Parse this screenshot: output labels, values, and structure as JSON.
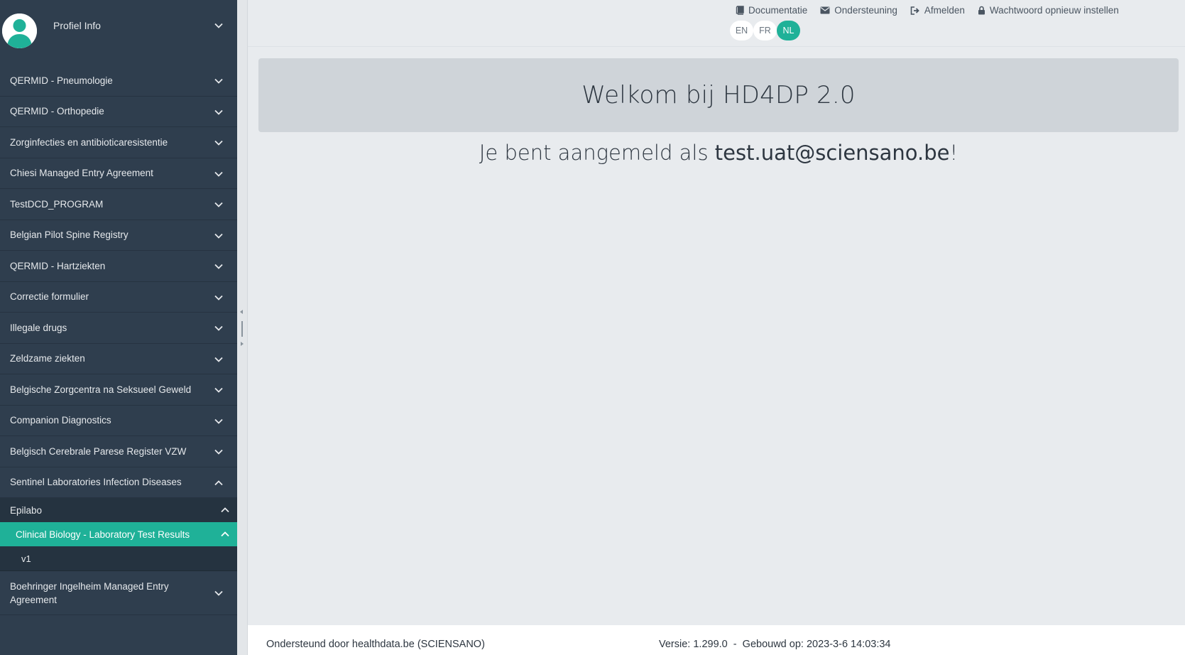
{
  "profile": {
    "label": "Profiel Info"
  },
  "sidebar": {
    "items": [
      {
        "label": "QERMID - Pneumologie"
      },
      {
        "label": "QERMID - Orthopedie"
      },
      {
        "label": "Zorginfecties en antibioticaresistentie"
      },
      {
        "label": "Chiesi Managed Entry Agreement"
      },
      {
        "label": "TestDCD_PROGRAM"
      },
      {
        "label": "Belgian Pilot Spine Registry"
      },
      {
        "label": "QERMID - Hartziekten"
      },
      {
        "label": "Correctie formulier"
      },
      {
        "label": "Illegale drugs"
      },
      {
        "label": "Zeldzame ziekten"
      },
      {
        "label": "Belgische Zorgcentra na Seksueel Geweld"
      },
      {
        "label": "Companion Diagnostics"
      },
      {
        "label": "Belgisch Cerebrale Parese Register VZW"
      },
      {
        "label": "Sentinel Laboratories Infection Diseases"
      }
    ],
    "sub_item": "Epilabo",
    "sub_active": "Clinical Biology - Laboratory Test Results",
    "sub_leaf": "v1",
    "last_item": "Boehringer Ingelheim Managed Entry Agreement"
  },
  "topbar": {
    "links": {
      "documentation": "Documentatie",
      "support": "Ondersteuning",
      "logout": "Afmelden",
      "reset_password": "Wachtwoord opnieuw instellen"
    },
    "languages": [
      "EN",
      "FR",
      "NL"
    ],
    "active_language": "NL"
  },
  "main": {
    "welcome": "Welkom bij HD4DP 2.0",
    "logged_in_prefix": "Je bent aangemeld als ",
    "email": "test.uat@sciensano.be",
    "logged_in_suffix": "!"
  },
  "footer": {
    "supported_by": "Ondersteund door healthdata.be (SCIENSANO)",
    "version": "Versie: 1.299.0  -  Gebouwd op: 2023-3-6 14:03:34"
  },
  "colors": {
    "sidebar_bg": "#2f3e4e",
    "accent": "#1fb198",
    "main_bg": "#e8ebee"
  }
}
